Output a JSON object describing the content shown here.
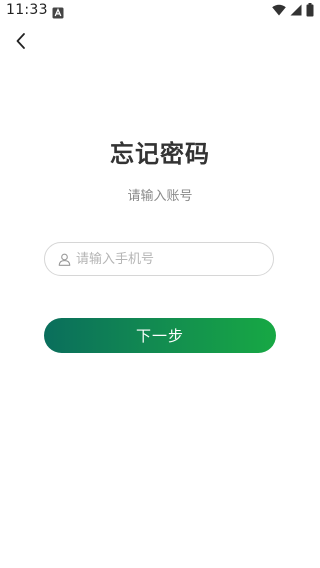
{
  "status_bar": {
    "time": "11:33",
    "icons": [
      "notification-a-icon",
      "wifi-icon",
      "cellular-signal-icon",
      "battery-icon"
    ]
  },
  "nav": {
    "back_icon": "chevron-left-icon"
  },
  "header": {
    "title": "忘记密码",
    "subtitle": "请输入账号"
  },
  "form": {
    "phone": {
      "icon": "user-icon",
      "placeholder": "请输入手机号",
      "value": ""
    },
    "next_label": "下一步"
  },
  "colors": {
    "accent_start": "#0a6e5c",
    "accent_end": "#17a844",
    "title": "#333333",
    "subtitle": "#8a8a8a"
  }
}
